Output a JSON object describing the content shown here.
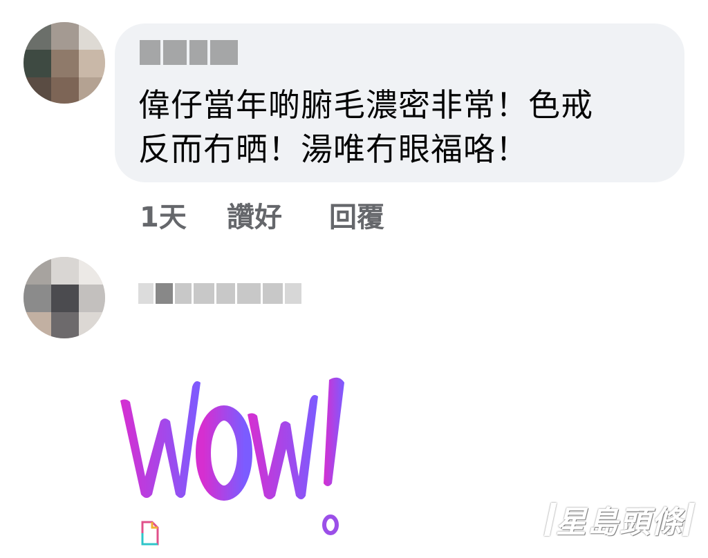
{
  "comment1": {
    "text": "偉仔當年啲腑毛濃密非常！色戒\n反而冇晒！湯唯冇眼福咯！",
    "time": "1天",
    "like": "讚好",
    "reply": "回覆"
  },
  "comment2": {
    "sticker": "WOW!"
  },
  "watermark": {
    "text": "星島頭條"
  },
  "colors": {
    "bubble": "#f0f2f5",
    "action_text": "#65676b",
    "sticker_gradient_start": "#d62fd0",
    "sticker_gradient_end": "#7b5cff"
  },
  "icons": [
    "avatar-placeholder",
    "document-icon"
  ]
}
